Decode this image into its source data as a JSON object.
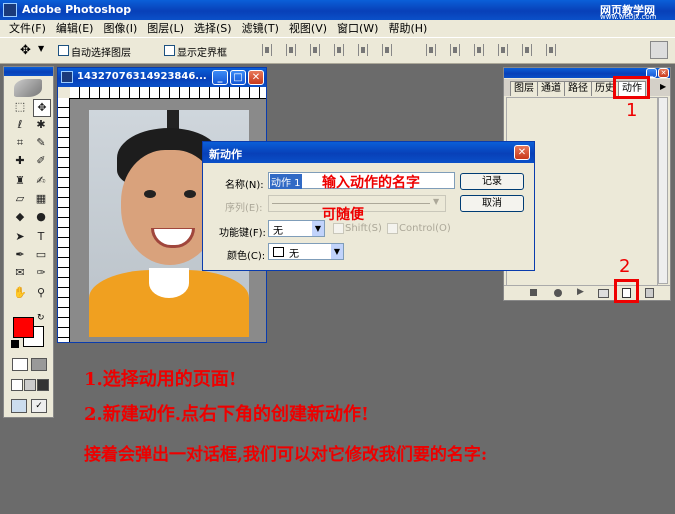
{
  "app": {
    "title": "Adobe Photoshop",
    "watermark_top": "网页教学网",
    "watermark_url": "www.webjx.com"
  },
  "menu": [
    "文件(F)",
    "编辑(E)",
    "图像(I)",
    "图层(L)",
    "选择(S)",
    "滤镜(T)",
    "视图(V)",
    "窗口(W)",
    "帮助(H)"
  ],
  "options": {
    "auto_select_label": "自动选择图层",
    "show_bounds_label": "显示定界框"
  },
  "document": {
    "title": "14327076314923846..."
  },
  "panel": {
    "tabs": [
      "图层",
      "通道",
      "路径",
      "历史",
      "动作"
    ],
    "active_tab": "动作"
  },
  "dialog": {
    "title": "新动作",
    "name_label": "名称(N):",
    "name_value": "动作 1",
    "set_label": "序列(E):",
    "hotkey_label": "功能键(F):",
    "hotkey_value": "无",
    "shift_label": "Shift(S)",
    "control_label": "Control(O)",
    "color_label": "颜色(C):",
    "color_value": "无",
    "record_button": "记录",
    "cancel_button": "取消"
  },
  "annotations": {
    "name_hint": "输入动作的名字",
    "optional_hint": "可随便",
    "marker_1": "1",
    "marker_2": "2",
    "step1": "1.选择动用的页面!",
    "step2": "2.新建动作.点右下角的创建新动作!",
    "step3": "接着会弹出一对话框,我们可以对它修改我们要的名字:"
  },
  "colors": {
    "foreground": "#ff0000",
    "background": "#ffffff",
    "annotation": "#e00000",
    "workspace": "#6b6b6b"
  }
}
